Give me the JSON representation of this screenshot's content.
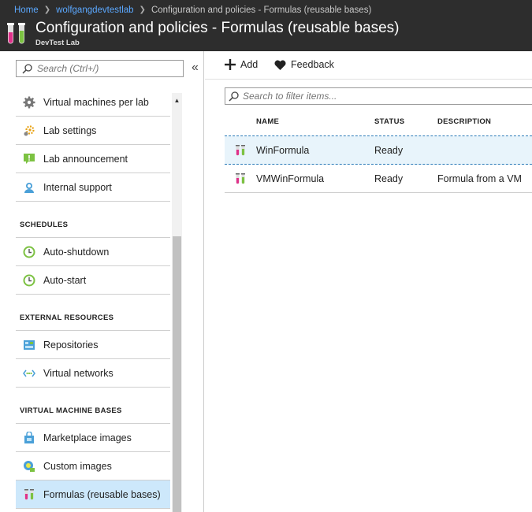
{
  "breadcrumb": [
    "Home",
    "wolfgangdevtestlab",
    "Configuration and policies - Formulas (reusable bases)"
  ],
  "header": {
    "title": "Configuration and policies - Formulas (reusable bases)",
    "subtitle": "DevTest Lab"
  },
  "sidebar": {
    "search_placeholder": "Search (Ctrl+/)",
    "collapse_glyph": "«",
    "items": [
      {
        "label": "Virtual machines per lab",
        "icon": "gear-icon"
      },
      {
        "label": "Lab settings",
        "icon": "settings-icon"
      },
      {
        "label": "Lab announcement",
        "icon": "announcement-icon"
      },
      {
        "label": "Internal support",
        "icon": "support-icon"
      }
    ],
    "sections": [
      {
        "title": "SCHEDULES",
        "items": [
          {
            "label": "Auto-shutdown",
            "icon": "clock-icon"
          },
          {
            "label": "Auto-start",
            "icon": "clock-icon"
          }
        ]
      },
      {
        "title": "EXTERNAL RESOURCES",
        "items": [
          {
            "label": "Repositories",
            "icon": "repository-icon"
          },
          {
            "label": "Virtual networks",
            "icon": "network-icon"
          }
        ]
      },
      {
        "title": "VIRTUAL MACHINE BASES",
        "items": [
          {
            "label": "Marketplace images",
            "icon": "marketplace-icon"
          },
          {
            "label": "Custom images",
            "icon": "custom-image-icon"
          },
          {
            "label": "Formulas (reusable bases)",
            "icon": "formula-icon",
            "active": true
          }
        ]
      }
    ]
  },
  "toolbar": {
    "add_label": "Add",
    "feedback_label": "Feedback"
  },
  "filter": {
    "placeholder": "Search to filter items..."
  },
  "table": {
    "columns": [
      "NAME",
      "STATUS",
      "DESCRIPTION"
    ],
    "rows": [
      {
        "name": "WinFormula",
        "status": "Ready",
        "description": ""
      },
      {
        "name": "VMWinFormula",
        "status": "Ready",
        "description": "Formula from a VM"
      }
    ]
  },
  "colors": {
    "header_bg": "#2d2d2d",
    "link_blue": "#5ba8ff",
    "active_item": "#cde8fb",
    "tube_pink": "#e0318a",
    "tube_green": "#7cc242"
  }
}
